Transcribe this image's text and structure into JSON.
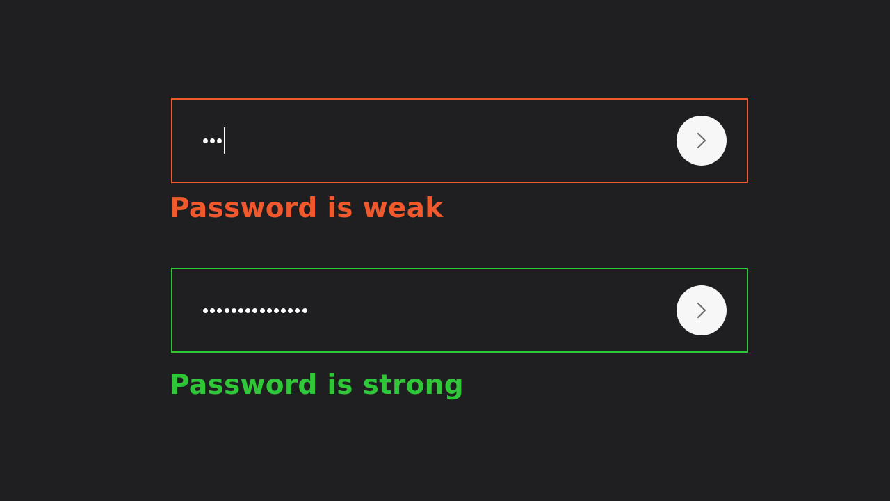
{
  "colors": {
    "background": "#1f1f21",
    "weak": "#f0592d",
    "strong": "#2fc638",
    "button_bg": "#f7f7f7",
    "chevron": "#6e6e6e",
    "dot": "#ffffff"
  },
  "weak_field": {
    "masked_length": 3,
    "has_caret": true,
    "message": "Password is weak"
  },
  "strong_field": {
    "masked_length": 15,
    "has_caret": false,
    "message": "Password is strong"
  },
  "icons": {
    "submit": "chevron-right-icon"
  }
}
